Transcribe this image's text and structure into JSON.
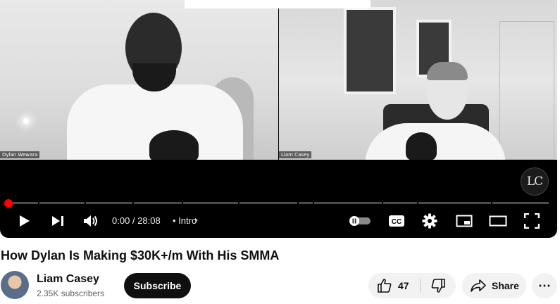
{
  "video": {
    "left_participant": "Dylan Wewara",
    "right_participant": "Liam Casey",
    "logo_text": "LC",
    "progress": 0.0
  },
  "controls": {
    "time_current": "0:00",
    "time_sep": " / ",
    "time_total": "28:08",
    "chapter_bullet": "•",
    "chapter": "Intro",
    "chapter_chevron": "›",
    "icons": [
      "play-icon",
      "next-icon",
      "volume-icon",
      "autoplay-toggle-icon",
      "cc-icon",
      "settings-icon",
      "miniplayer-icon",
      "theater-icon",
      "fullscreen-icon"
    ],
    "cc_label": "CC"
  },
  "title": "How Dylan Is Making $30K+/m With His SMMA",
  "channel": {
    "name": "Liam Casey",
    "subscribers": "2.35K subscribers",
    "subscribe_label": "Subscribe"
  },
  "actions": {
    "like_count": "47",
    "share_label": "Share",
    "more_label": "⋯"
  },
  "colors": {
    "accent": "#ff0000",
    "pill_bg": "#f2f2f2",
    "text": "#0f0f0f"
  }
}
